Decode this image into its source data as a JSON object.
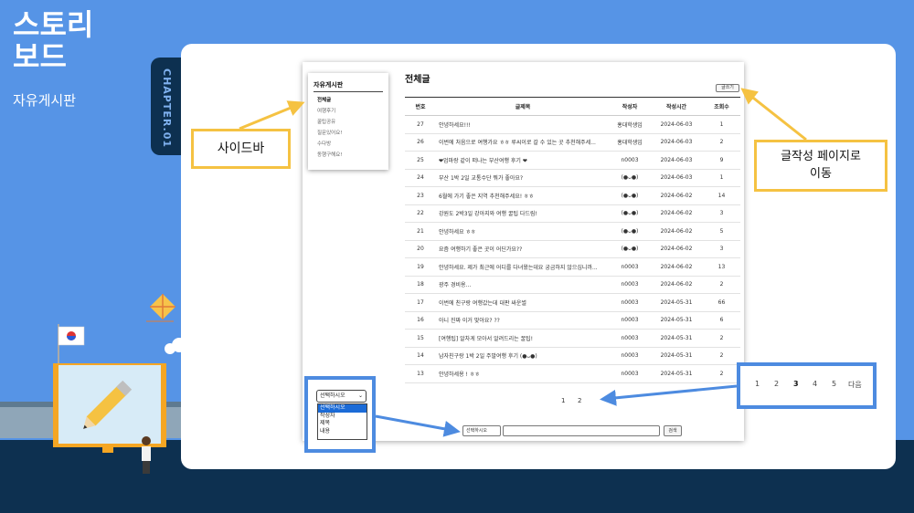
{
  "header": {
    "title_line1": "스토리",
    "title_line2": "보드",
    "subtitle": "자유게시판"
  },
  "chapter_tab": {
    "label": "CHAPTER.01"
  },
  "sidebar": {
    "title": "자유게시판",
    "items": [
      {
        "label": "전체글",
        "active": true
      },
      {
        "label": "여행후기"
      },
      {
        "label": "꿀팁공유"
      },
      {
        "label": "질문있어요!"
      },
      {
        "label": "수다방"
      },
      {
        "label": "동행구해요!"
      }
    ]
  },
  "board": {
    "title": "전체글",
    "write_button": "글쓰기",
    "columns": [
      "번호",
      "글제목",
      "작성자",
      "작성시간",
      "조회수"
    ],
    "rows": [
      [
        "27",
        "안녕하세요!!!",
        "홍대학생임",
        "2024-06-03",
        "1"
      ],
      [
        "26",
        "이번에 처음으로 여행가요 ㅎㅎ 루씨이로 갈 수 있는 곳 추천해주세...",
        "홍대학생임",
        "2024-06-03",
        "2"
      ],
      [
        "25",
        "❤엄마랑 같이 떠나는 부산여행 후기 ❤",
        "n0003",
        "2024-06-03",
        "9"
      ],
      [
        "24",
        "부산 1박 2일 교통수단 뭐가 좋아요?",
        "(●ᴗ●)",
        "2024-06-03",
        "1"
      ],
      [
        "23",
        "6월에 가기 좋은 지역 추천해주세요! ㅎㅎ",
        "(●ᴗ●)",
        "2024-06-02",
        "14"
      ],
      [
        "22",
        "강원도 2박3일 강아지와 여행 꿀팁 다드림!",
        "(●ᴗ●)",
        "2024-06-02",
        "3"
      ],
      [
        "21",
        "안녕하세요 ㅎㅎ",
        "(●ᴗ●)",
        "2024-06-02",
        "5"
      ],
      [
        "20",
        "요즘 여행하기 좋은 곳이 어딘가요??",
        "(●ᴗ●)",
        "2024-06-02",
        "3"
      ],
      [
        "19",
        "안녕하세요. 제가 최근에 어디를 다녀왔는데요 궁금하지 않으십니까...",
        "n0003",
        "2024-06-02",
        "13"
      ],
      [
        "18",
        "광주 경비용...",
        "n0003",
        "2024-06-02",
        "2"
      ],
      [
        "17",
        "이번에 친구랑 여행갔는데 대판 싸운썰",
        "n0003",
        "2024-05-31",
        "66"
      ],
      [
        "16",
        "아니 진짜 이거 맞아요? ??",
        "n0003",
        "2024-05-31",
        "6"
      ],
      [
        "15",
        "[여행팁] 알차게 모아서 알려드리는 꿀팁!",
        "n0003",
        "2024-05-31",
        "2"
      ],
      [
        "14",
        "남자친구랑 1박 2일 주말여행 후기 (●ᴗ●)",
        "n0003",
        "2024-05-31",
        "2"
      ],
      [
        "13",
        "안녕하세용 ! ㅎㅎ",
        "n0003",
        "2024-05-31",
        "2"
      ]
    ]
  },
  "pagination": [
    "1",
    "2"
  ],
  "search": {
    "select_value": "선택하시오",
    "button": "검색"
  },
  "dropdown_zoom": {
    "selected": "선택하시오",
    "options": [
      "선택하시오",
      "작성자",
      "제목",
      "내용"
    ]
  },
  "pagination_zoom": {
    "pages": [
      "1",
      "2",
      "3",
      "4",
      "5"
    ],
    "current": "3",
    "next": "다음"
  },
  "callouts": {
    "sidebar": "사이드바",
    "write_page_line1": "글작성 페이지로",
    "write_page_line2": "이동"
  },
  "colors": {
    "background": "#5694e6",
    "navy": "#0d3050",
    "callout_border": "#f5c242",
    "zoom_border": "#4d8be0"
  }
}
